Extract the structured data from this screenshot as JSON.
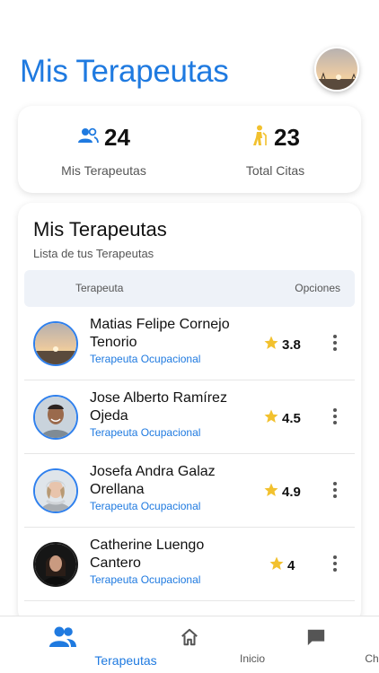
{
  "header": {
    "title": "Mis Terapeutas",
    "avatar": "profile-avatar"
  },
  "stats": [
    {
      "icon": "people-icon",
      "value": "24",
      "label": "Mis Terapeutas",
      "color": "#1f7ae0"
    },
    {
      "icon": "person-cane-icon",
      "value": "23",
      "label": "Total Citas",
      "color": "#f2c12e"
    }
  ],
  "list": {
    "title": "Mis Terapeutas",
    "subtitle": "Lista de tus Terapeutas",
    "columns": {
      "therapist": "Terapeuta",
      "options": "Opciones"
    },
    "rows": [
      {
        "name": "Matias Felipe Cornejo Tenorio",
        "specialty": "Terapeuta Ocupacional",
        "rating": "3.8",
        "avatar": "sunset-photo"
      },
      {
        "name": "Jose Alberto Ramírez Ojeda",
        "specialty": "Terapeuta Ocupacional",
        "rating": "4.5",
        "avatar": "man-portrait"
      },
      {
        "name": "Josefa Andra Galaz Orellana",
        "specialty": "Terapeuta Ocupacional",
        "rating": "4.9",
        "avatar": "woman-winter-portrait"
      },
      {
        "name": "Catherine Luengo Cantero",
        "specialty": "Terapeuta Ocupacional",
        "rating": "4",
        "avatar": "woman-dark-portrait"
      }
    ]
  },
  "nav": [
    {
      "label": "Terapeutas",
      "icon": "people-icon",
      "active": true
    },
    {
      "label": "Inicio",
      "icon": "home-icon",
      "active": false
    },
    {
      "label": "Chats",
      "icon": "chat-icon",
      "active": false
    }
  ],
  "colors": {
    "accent": "#1f7ae0",
    "star": "#f2c12e"
  }
}
